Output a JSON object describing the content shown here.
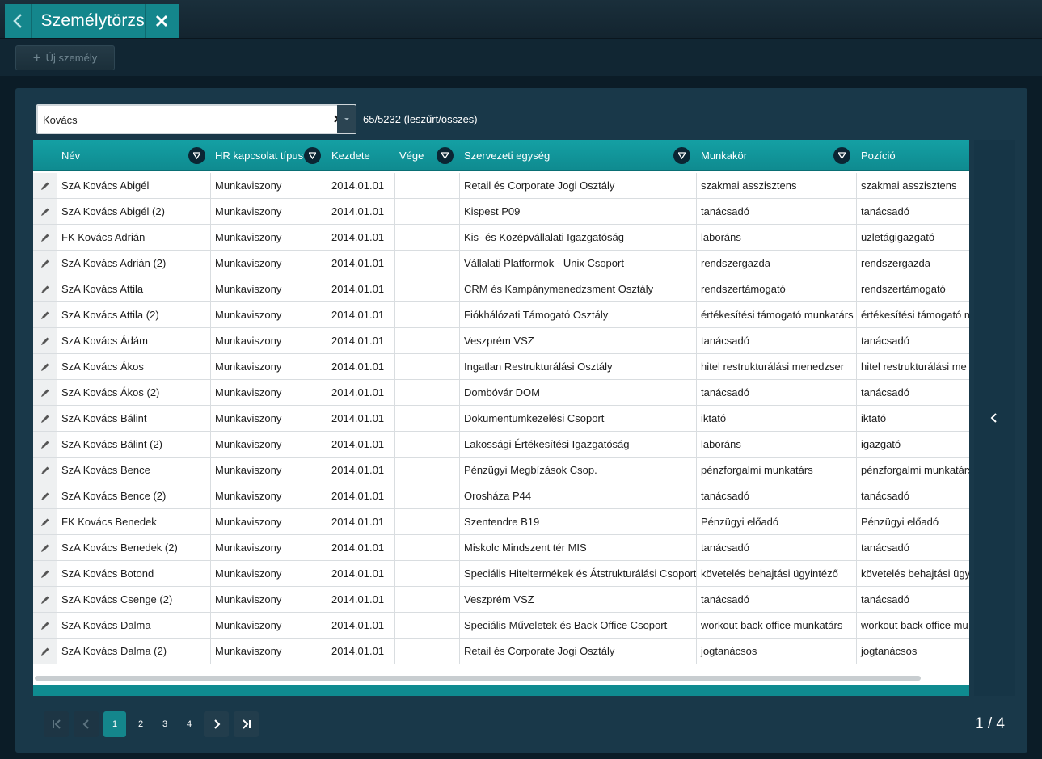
{
  "tab": {
    "title": "Személytörzs"
  },
  "toolbar": {
    "new_person_label": "Új személy"
  },
  "search": {
    "value": "Kovács",
    "count_text": "65/5232 (leszűrt/összes)"
  },
  "columns": [
    {
      "label": "Név",
      "filter": true
    },
    {
      "label": "HR kapcsolat típus",
      "filter": true
    },
    {
      "label": "Kezdete",
      "filter": false
    },
    {
      "label": "Vége",
      "filter": true
    },
    {
      "label": "Szervezeti egység",
      "filter": true
    },
    {
      "label": "Munkakör",
      "filter": true
    },
    {
      "label": "Pozíció",
      "filter": false
    }
  ],
  "rows": [
    {
      "name": "SzA Kovács Abigél",
      "hr": "Munkaviszony",
      "start": "2014.01.01",
      "end": "",
      "org": "Retail és Corporate Jogi Osztály",
      "job": "szakmai asszisztens",
      "position": "szakmai asszisztens"
    },
    {
      "name": "SzA Kovács Abigél (2)",
      "hr": "Munkaviszony",
      "start": "2014.01.01",
      "end": "",
      "org": "Kispest P09",
      "job": "tanácsadó",
      "position": "tanácsadó"
    },
    {
      "name": "FK Kovács Adrián",
      "hr": "Munkaviszony",
      "start": "2014.01.01",
      "end": "",
      "org": "Kis- és Középvállalati Igazgatóság",
      "job": "laboráns",
      "position": "üzletágigazgató"
    },
    {
      "name": "SzA Kovács Adrián (2)",
      "hr": "Munkaviszony",
      "start": "2014.01.01",
      "end": "",
      "org": "Vállalati Platformok - Unix Csoport",
      "job": "rendszergazda",
      "position": "rendszergazda"
    },
    {
      "name": "SzA Kovács Attila",
      "hr": "Munkaviszony",
      "start": "2014.01.01",
      "end": "",
      "org": "CRM és Kampánymenedzsment Osztály",
      "job": "rendszertámogató",
      "position": "rendszertámogató"
    },
    {
      "name": "SzA Kovács Attila (2)",
      "hr": "Munkaviszony",
      "start": "2014.01.01",
      "end": "",
      "org": "Fiókhálózati Támogató Osztály",
      "job": "értékesítési támogató munkatárs",
      "position": "értékesítési támogató m"
    },
    {
      "name": "SzA Kovács Ádám",
      "hr": "Munkaviszony",
      "start": "2014.01.01",
      "end": "",
      "org": "Veszprém VSZ",
      "job": "tanácsadó",
      "position": "tanácsadó"
    },
    {
      "name": "SzA Kovács Ákos",
      "hr": "Munkaviszony",
      "start": "2014.01.01",
      "end": "",
      "org": "Ingatlan Restrukturálási Osztály",
      "job": "hitel restrukturálási menedzser",
      "position": "hitel restrukturálási me"
    },
    {
      "name": "SzA Kovács Ákos (2)",
      "hr": "Munkaviszony",
      "start": "2014.01.01",
      "end": "",
      "org": "Dombóvár DOM",
      "job": "tanácsadó",
      "position": "tanácsadó"
    },
    {
      "name": "SzA Kovács Bálint",
      "hr": "Munkaviszony",
      "start": "2014.01.01",
      "end": "",
      "org": "Dokumentumkezelési Csoport",
      "job": "iktató",
      "position": "iktató"
    },
    {
      "name": "SzA Kovács Bálint (2)",
      "hr": "Munkaviszony",
      "start": "2014.01.01",
      "end": "",
      "org": "Lakossági Értékesítési Igazgatóság",
      "job": "laboráns",
      "position": "igazgató"
    },
    {
      "name": "SzA Kovács Bence",
      "hr": "Munkaviszony",
      "start": "2014.01.01",
      "end": "",
      "org": "Pénzügyi Megbízások Csop.",
      "job": "pénzforgalmi munkatárs",
      "position": "pénzforgalmi munkatárs"
    },
    {
      "name": "SzA Kovács Bence (2)",
      "hr": "Munkaviszony",
      "start": "2014.01.01",
      "end": "",
      "org": "Orosháza P44",
      "job": "tanácsadó",
      "position": "tanácsadó"
    },
    {
      "name": "FK Kovács Benedek",
      "hr": "Munkaviszony",
      "start": "2014.01.01",
      "end": "",
      "org": "Szentendre B19",
      "job": "Pénzügyi előadó",
      "position": "Pénzügyi előadó"
    },
    {
      "name": "SzA Kovács Benedek (2)",
      "hr": "Munkaviszony",
      "start": "2014.01.01",
      "end": "",
      "org": "Miskolc Mindszent tér MIS",
      "job": "tanácsadó",
      "position": "tanácsadó"
    },
    {
      "name": "SzA Kovács Botond",
      "hr": "Munkaviszony",
      "start": "2014.01.01",
      "end": "",
      "org": "Speciális Hiteltermékek és Átstrukturálási Csoport",
      "job": "követelés behajtási ügyintéző",
      "position": "követelés behajtási ügyi"
    },
    {
      "name": "SzA Kovács Csenge (2)",
      "hr": "Munkaviszony",
      "start": "2014.01.01",
      "end": "",
      "org": "Veszprém VSZ",
      "job": "tanácsadó",
      "position": "tanácsadó"
    },
    {
      "name": "SzA Kovács Dalma",
      "hr": "Munkaviszony",
      "start": "2014.01.01",
      "end": "",
      "org": "Speciális Műveletek és Back Office Csoport",
      "job": "workout back office munkatárs",
      "position": "workout back office mu"
    },
    {
      "name": "SzA Kovács Dalma (2)",
      "hr": "Munkaviszony",
      "start": "2014.01.01",
      "end": "",
      "org": "Retail és Corporate Jogi Osztály",
      "job": "jogtanácsos",
      "position": "jogtanácsos"
    }
  ],
  "pager": {
    "pages": [
      "1",
      "2",
      "3",
      "4"
    ],
    "current": "1",
    "indicator": "1 / 4"
  },
  "colors": {
    "accent": "#14868c",
    "panel": "#193849",
    "background": "#0b1c27"
  }
}
